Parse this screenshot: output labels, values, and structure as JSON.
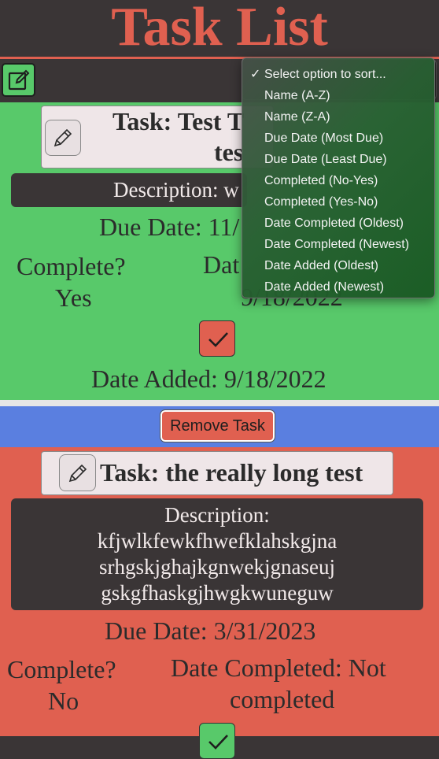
{
  "app": {
    "title": "Task List"
  },
  "sort": {
    "selected": "Select option to sort...",
    "check_mark": "✓",
    "options": [
      "Select option to sort...",
      "Name (A-Z)",
      "Name (Z-A)",
      "Due Date (Most Due)",
      "Due Date (Least Due)",
      "Completed (No-Yes)",
      "Completed (Yes-No)",
      "Date Completed (Oldest)",
      "Date Completed (Newest)",
      "Date Added (Oldest)",
      "Date Added (Newest)"
    ]
  },
  "tasks": [
    {
      "title_line1": "Task: Test T",
      "title_line2": "tes",
      "description": "Description: w",
      "due": "Due Date: 11/",
      "complete_label": "Complete?",
      "complete_value": "Yes",
      "date_completed_label": "Dat",
      "date_completed_value": "9/18/2022",
      "date_added": "Date Added: 9/18/2022",
      "remove_label": "Remove Task",
      "color": "#58c96a"
    },
    {
      "title": "Task: the really long test",
      "description_label": "Description:",
      "description_lines": [
        "kfjwlkfewkfhwefklahskgjna",
        "srhgskjghajkgnwekjgnaseuj",
        "gskgfhaskgjhwgkwuneguw"
      ],
      "due": "Due Date: 3/31/2023",
      "complete_label": "Complete?",
      "complete_value": "No",
      "date_completed_line1": "Date Completed: Not",
      "date_completed_line2": "completed",
      "color": "#e06050"
    }
  ],
  "colors": {
    "header_bg": "#3a3536",
    "accent_red": "#e06050",
    "accent_green": "#58c96a",
    "accent_blue": "#5a7fe0"
  }
}
